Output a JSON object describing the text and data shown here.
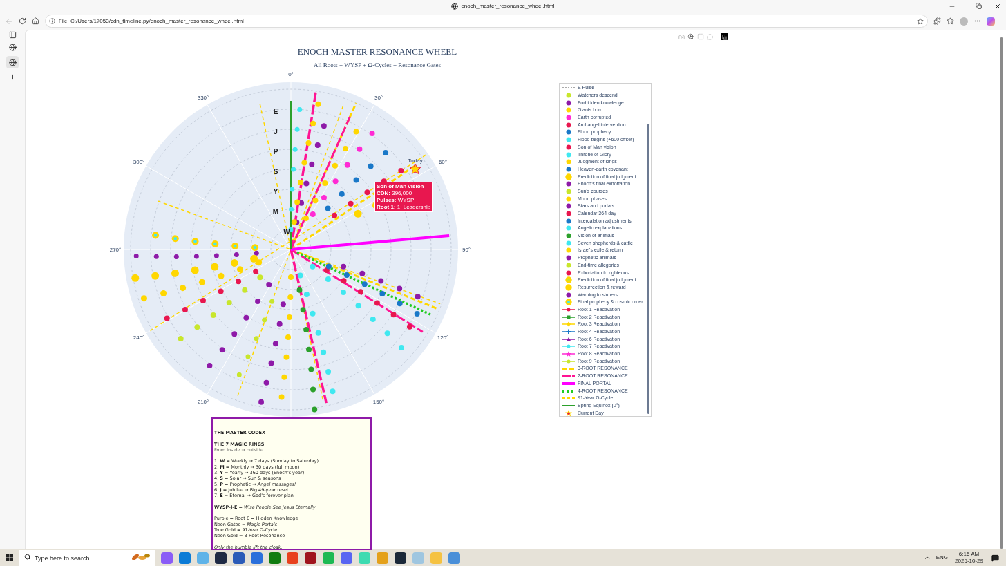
{
  "browser": {
    "tab_title": "enoch_master_resonance_wheel.html",
    "address_label": "File",
    "url": "C:/Users/17053/cdn_timeline.py/enoch_master_resonance_wheel.html"
  },
  "chart": {
    "title": "ENOCH MASTER RESONANCE WHEEL",
    "subtitle": "All Roots + WYSP + Ω-Cycles + Resonance Gates",
    "angle_labels": [
      "0°",
      "30°",
      "60°",
      "90°",
      "120°",
      "150°",
      "210°",
      "240°",
      "270°",
      "300°",
      "330°"
    ],
    "ring_labels": [
      "E",
      "J",
      "P",
      "S",
      "Y",
      "M",
      "W"
    ],
    "marker_label": "Today",
    "tooltip": {
      "title": "Son of Man vision",
      "lines": [
        "**CDN:** 396,000",
        "**Pulses:** WYSP",
        "**Root 1:** 1: Leadership"
      ]
    },
    "legend": [
      {
        "label": "E Pulse",
        "kind": "dotted-line",
        "color": "#aaaaaa"
      },
      {
        "label": "Watchers descend",
        "kind": "dot",
        "color": "#c8e62c"
      },
      {
        "label": "Forbidden knowledge",
        "kind": "dot",
        "color": "#8e1aa8"
      },
      {
        "label": "Giants born",
        "kind": "dot",
        "color": "#ffd700"
      },
      {
        "label": "Earth corrupted",
        "kind": "dot",
        "color": "#ff2ad4"
      },
      {
        "label": "Archangel intervention",
        "kind": "dot",
        "color": "#e8174f"
      },
      {
        "label": "Flood prophecy",
        "kind": "dot",
        "color": "#1a78c8"
      },
      {
        "label": "Flood begins (+600 offset)",
        "kind": "dot",
        "color": "#40e8f0"
      },
      {
        "label": "Son of Man vision",
        "kind": "dot",
        "color": "#e8174f"
      },
      {
        "label": "Throne of Glory",
        "kind": "dot",
        "color": "#40e8f0"
      },
      {
        "label": "Judgment of kings",
        "kind": "dot",
        "color": "#ffd700"
      },
      {
        "label": "Heaven-earth covenant",
        "kind": "dot",
        "color": "#1a78c8"
      },
      {
        "label": "Prediction of final judgment",
        "kind": "big-dot",
        "color": "#ffd700"
      },
      {
        "label": "Enoch's final exhortation",
        "kind": "dot",
        "color": "#8e1aa8"
      },
      {
        "label": "Sun's courses",
        "kind": "dot",
        "color": "#c8e62c"
      },
      {
        "label": "Moon phases",
        "kind": "dot",
        "color": "#ffd700"
      },
      {
        "label": "Stars and portals",
        "kind": "dot",
        "color": "#8e1aa8"
      },
      {
        "label": "Calendar 364-day",
        "kind": "dot",
        "color": "#e8174f"
      },
      {
        "label": "Intercalation adjustments",
        "kind": "dot",
        "color": "#1a78c8"
      },
      {
        "label": "Angelic explanations",
        "kind": "dot",
        "color": "#40e8f0"
      },
      {
        "label": "Vision of animals",
        "kind": "dot",
        "color": "#2ca02c"
      },
      {
        "label": "Seven shepherds & cattle",
        "kind": "dot",
        "color": "#40e8f0"
      },
      {
        "label": "Israel's exile & return",
        "kind": "dot",
        "color": "#ffd700"
      },
      {
        "label": "Prophetic animals",
        "kind": "dot",
        "color": "#8e1aa8"
      },
      {
        "label": "End-time allegories",
        "kind": "dot",
        "color": "#c8e62c"
      },
      {
        "label": "Exhortation to righteous",
        "kind": "dot",
        "color": "#e8174f"
      },
      {
        "label": "Prediction of final judgment",
        "kind": "lime-core-dot",
        "color": "#ffd700"
      },
      {
        "label": "Resurrection & reward",
        "kind": "big-dot",
        "color": "#ffd700"
      },
      {
        "label": "Warning to sinners",
        "kind": "dot",
        "color": "#8e1aa8"
      },
      {
        "label": "Final prophecy & cosmic order",
        "kind": "cyan-core-dot",
        "color": "#ffd700"
      },
      {
        "label": "Root 1 Reactivation",
        "kind": "circle-line",
        "color": "#e8174f"
      },
      {
        "label": "Root 2 Reactivation",
        "kind": "square-line",
        "color": "#2ca02c"
      },
      {
        "label": "Root 3 Reactivation",
        "kind": "diamond-line",
        "color": "#ffd700"
      },
      {
        "label": "Root 4 Reactivation",
        "kind": "cross-line",
        "color": "#1a78c8"
      },
      {
        "label": "Root 6 Reactivation",
        "kind": "triangle-line",
        "color": "#8e1aa8"
      },
      {
        "label": "Root 7 Reactivation",
        "kind": "circle-line",
        "color": "#40e8f0"
      },
      {
        "label": "Root 8 Reactivation",
        "kind": "star-line",
        "color": "#ff2ad4"
      },
      {
        "label": "Root 9 Reactivation",
        "kind": "circle-line",
        "color": "#c8e62c"
      },
      {
        "label": "3-ROOT RESONANCE",
        "kind": "dash-line",
        "color": "#ffd700"
      },
      {
        "label": "2-ROOT RESONANCE",
        "kind": "long-dash-line",
        "color": "#ff1493"
      },
      {
        "label": "FINAL PORTAL",
        "kind": "thick-line",
        "color": "#ff00ff"
      },
      {
        "label": "4-ROOT RESONANCE",
        "kind": "dotted-thick-line",
        "color": "#22cc22"
      },
      {
        "label": "91-Year Ω-Cycle",
        "kind": "thin-dash-line",
        "color": "#ffd700"
      },
      {
        "label": "Spring Equinox (0°)",
        "kind": "line",
        "color": "#2ca02c"
      },
      {
        "label": "Current Day",
        "kind": "star",
        "color": "#ffd700"
      }
    ]
  },
  "codex": {
    "sections": [
      [
        {
          "kind": "heading",
          "text": "THE MASTER CODEX"
        }
      ],
      [
        {
          "kind": "heading",
          "text": "THE 7 MAGIC RINGS"
        },
        {
          "kind": "subtle",
          "text": "From inside → outside"
        }
      ],
      [
        {
          "kind": "text",
          "text": "1. **W** = Weekly → 7 days (Sunday to Saturday)"
        },
        {
          "kind": "text",
          "text": "2. **M** = Monthly → 30 days (full moon)"
        },
        {
          "kind": "text",
          "text": "3. **Y** = Yearly → 360 days (Enoch's year)"
        },
        {
          "kind": "text",
          "text": "4. **S** = Solar → Sun & seasons"
        },
        {
          "kind": "text",
          "text": "5. **P** = Prophetic → *Angel messages!*"
        },
        {
          "kind": "text",
          "text": "6. **J** = Jubilee → Big 49-year reset"
        },
        {
          "kind": "text",
          "text": "7. **E** = Eternal → God's forever plan"
        }
      ],
      [
        {
          "kind": "text",
          "text": "**WYSP-J-E** = *Wise People See Jesus Eternally*"
        }
      ],
      [
        {
          "kind": "text",
          "text": "Purple = Root 6 = Hidden Knowledge"
        },
        {
          "kind": "text",
          "text": "Neon Gates = *Magic Portals*"
        },
        {
          "kind": "text",
          "text": "True Gold = 91-Year Ω-Cycle"
        },
        {
          "kind": "text",
          "text": "Neon Gold = 3-Root Resonance"
        }
      ],
      [
        {
          "kind": "note",
          "text": "Only the humble lift the cloak."
        }
      ]
    ]
  },
  "taskbar": {
    "search_placeholder": "Type here to search",
    "language": "ENG",
    "time": "6:15 AM",
    "date": "2025-10-29"
  }
}
